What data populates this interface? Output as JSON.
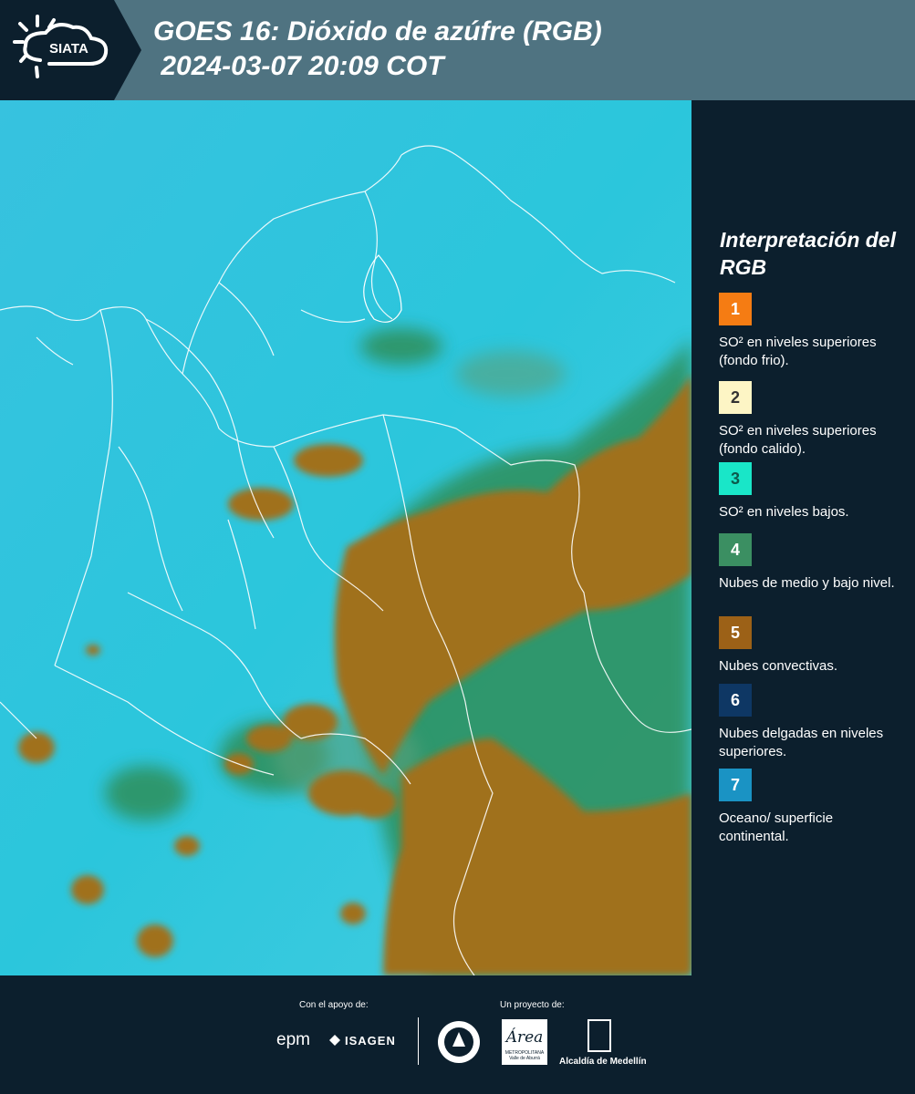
{
  "header": {
    "logo_text": "SIATA",
    "title": "GOES 16: Dióxido de azúfre (RGB)\n 2024-03-07 20:09 COT"
  },
  "legend": {
    "title": "Interpretación del RGB",
    "items": [
      {
        "num": "1",
        "text": "SO² en niveles superiores (fondo frio).",
        "color": "#f57c13",
        "num_color": "#ffffff"
      },
      {
        "num": "2",
        "text": "SO² en niveles superiores (fondo calido).",
        "color": "#fdf5c5",
        "num_color": "#333333"
      },
      {
        "num": "3",
        "text": "SO² en niveles bajos.",
        "color": "#19e6c8",
        "num_color": "#0c5a4c"
      },
      {
        "num": "4",
        "text": "Nubes de medio y bajo nivel.",
        "color": "#3b8f62",
        "num_color": "#ffffff"
      },
      {
        "num": "5",
        "text": "Nubes convectivas.",
        "color": "#9c6117",
        "num_color": "#ffffff"
      },
      {
        "num": "6",
        "text": "Nubes delgadas en niveles superiores.",
        "color": "#0e3764",
        "num_color": "#ffffff"
      },
      {
        "num": "7",
        "text": "Oceano/ superficie continental.",
        "color": "#1a93c4",
        "num_color": "#ffffff"
      }
    ]
  },
  "footer": {
    "support_label": "Con el apoyo de:",
    "project_label": "Un proyecto de:",
    "epm": "epm",
    "isagen": "ISAGEN",
    "amva": "Área",
    "amva_sub": "METROPOLITANA Valle de Aburrá",
    "alcaldia": "Alcaldía de Medellín"
  },
  "colors": {
    "background": "#0c1f2d",
    "header": "#4f7381",
    "sky": "#2bc3dd",
    "cloud_convective": "#a0711e",
    "cloud_low": "#2e8f56"
  }
}
